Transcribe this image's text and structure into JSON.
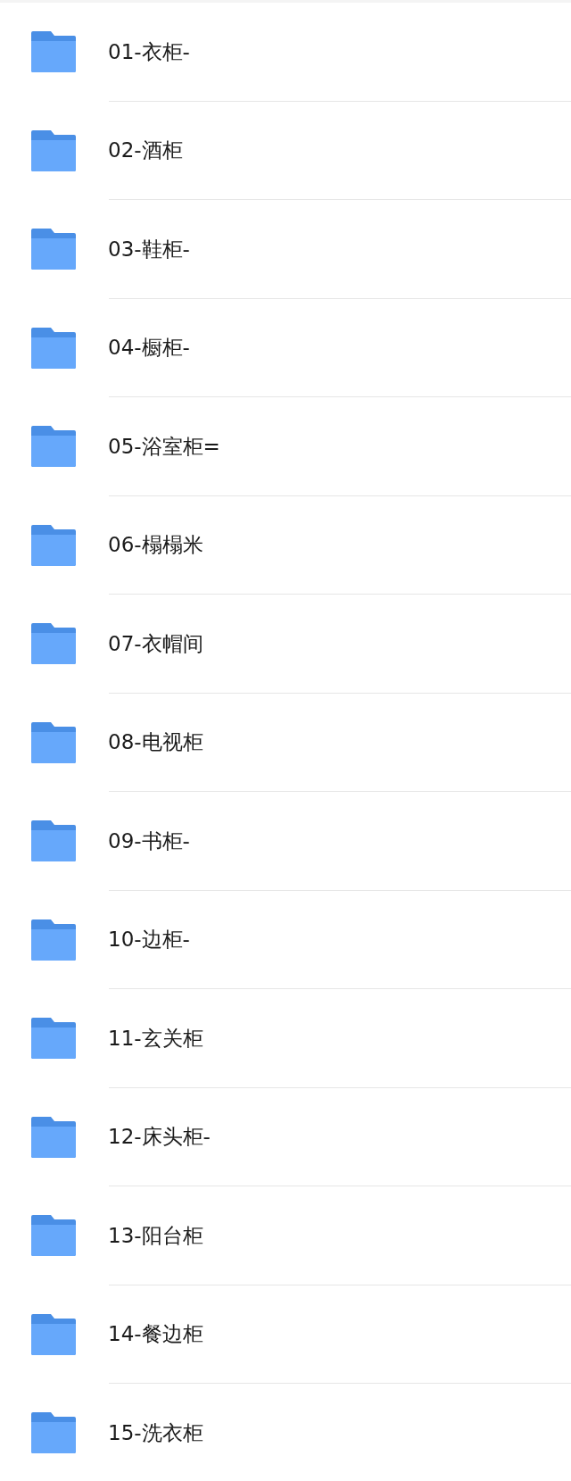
{
  "folders": [
    {
      "name": "01-衣柜-"
    },
    {
      "name": "02-酒柜"
    },
    {
      "name": "03-鞋柜-"
    },
    {
      "name": "04-橱柜-"
    },
    {
      "name": "05-浴室柜="
    },
    {
      "name": "06-榻榻米"
    },
    {
      "name": "07-衣帽间"
    },
    {
      "name": "08-电视柜"
    },
    {
      "name": "09-书柜-"
    },
    {
      "name": "10-边柜-"
    },
    {
      "name": "11-玄关柜"
    },
    {
      "name": "12-床头柜-"
    },
    {
      "name": "13-阳台柜"
    },
    {
      "name": "14-餐边柜"
    },
    {
      "name": "15-洗衣柜"
    }
  ]
}
